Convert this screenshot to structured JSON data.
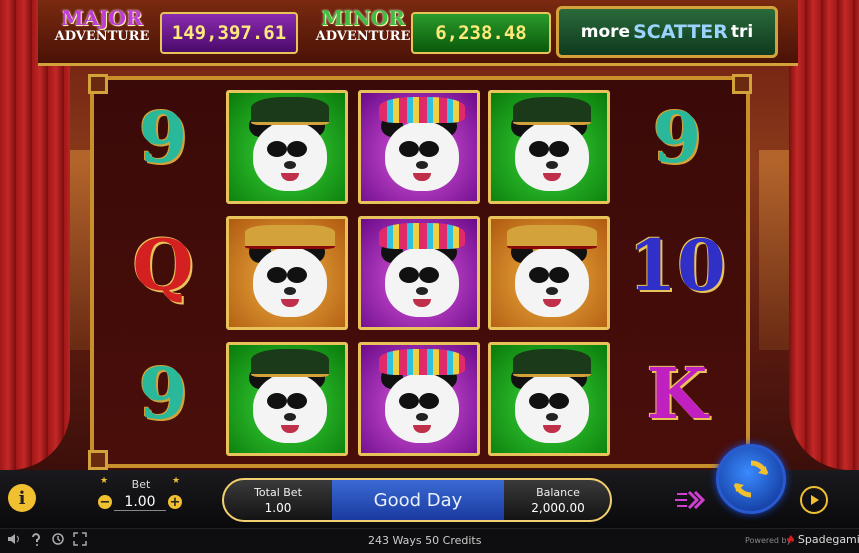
{
  "header": {
    "major_label_top": "MAJOR",
    "major_label_bottom": "ADVENTURE",
    "major_value": "149,397.61",
    "minor_label_top": "MINOR",
    "minor_label_bottom": "ADVENTURE",
    "minor_value": "6,238.48",
    "marquee_pre": "more",
    "marquee_highlight": "SCATTER",
    "marquee_post": "tri"
  },
  "reels": [
    [
      "9",
      "Q",
      "9"
    ],
    [
      "panda-green",
      "panda-orange",
      "panda-green"
    ],
    [
      "panda-purple",
      "panda-purple",
      "panda-purple"
    ],
    [
      "panda-green",
      "panda-orange",
      "panda-green"
    ],
    [
      "9",
      "10",
      "K"
    ]
  ],
  "controls": {
    "bet_label": "Bet",
    "bet_value": "1.00",
    "minus": "−",
    "plus": "+",
    "total_bet_label": "Total Bet",
    "total_bet_value": "1.00",
    "message": "Good Day",
    "balance_label": "Balance",
    "balance_value": "2,000.00",
    "info": "i",
    "star": "★"
  },
  "footer": {
    "ways": "243 Ways  50 Credits",
    "powered_by": "Powered by",
    "brand": "Spadegaming"
  },
  "colors": {
    "gold": "#e8c35a",
    "major": "#c03bd8",
    "minor": "#3fbf3f",
    "spin": "#3a8aff"
  }
}
